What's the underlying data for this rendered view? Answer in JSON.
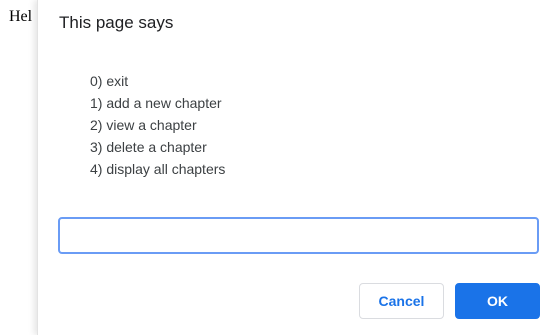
{
  "background": {
    "text": "Hel"
  },
  "dialog": {
    "title": "This page says",
    "message_lines": [
      "0) exit",
      "1) add a new chapter",
      "2) view a chapter",
      "3) delete a chapter",
      "4) display all chapters"
    ],
    "input": {
      "value": "",
      "placeholder": ""
    },
    "cancel_label": "Cancel",
    "ok_label": "OK",
    "accent_color": "#1a73e8",
    "focus_border_color": "#6a9cf5"
  }
}
